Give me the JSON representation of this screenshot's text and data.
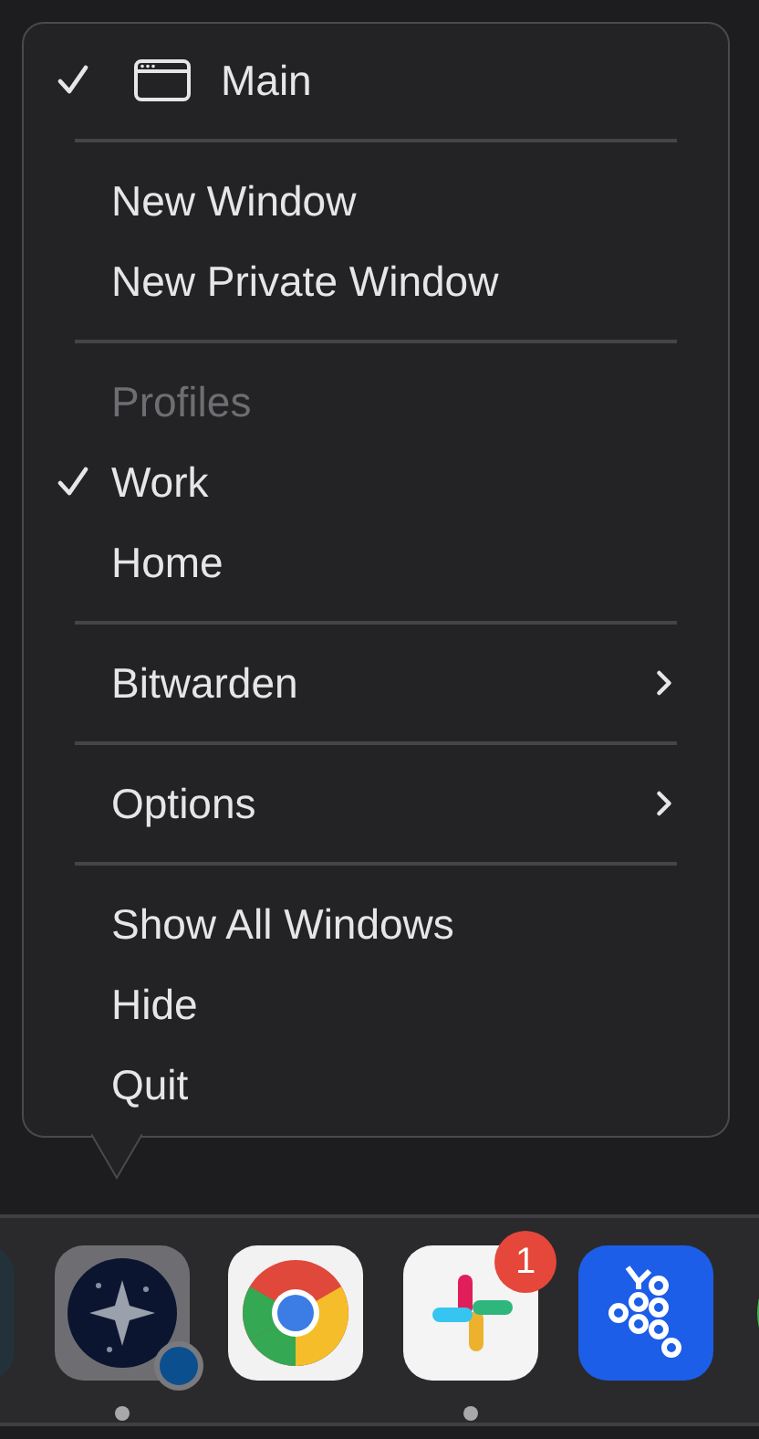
{
  "menu": {
    "sections": [
      {
        "items": [
          {
            "kind": "window",
            "label": "Main",
            "checked": true
          }
        ]
      },
      {
        "items": [
          {
            "kind": "item",
            "label": "New Window",
            "checked": false
          },
          {
            "kind": "item",
            "label": "New Private Window",
            "checked": false
          }
        ]
      },
      {
        "items": [
          {
            "kind": "header",
            "label": "Profiles"
          },
          {
            "kind": "item",
            "label": "Work",
            "checked": true
          },
          {
            "kind": "item",
            "label": "Home",
            "checked": false
          }
        ]
      },
      {
        "items": [
          {
            "kind": "submenu",
            "label": "Bitwarden",
            "checked": false
          }
        ]
      },
      {
        "items": [
          {
            "kind": "submenu",
            "label": "Options",
            "checked": false
          }
        ]
      },
      {
        "items": [
          {
            "kind": "item",
            "label": "Show All Windows",
            "checked": false
          },
          {
            "kind": "item",
            "label": "Hide",
            "checked": false
          },
          {
            "kind": "item",
            "label": "Quit",
            "checked": false
          }
        ]
      }
    ]
  },
  "dock": {
    "apps": [
      {
        "kind": "partial-dark",
        "running": false
      },
      {
        "kind": "sparkle",
        "running": true,
        "status_dot": true
      },
      {
        "kind": "ring",
        "running": false
      },
      {
        "kind": "hash",
        "running": true,
        "badge": "1"
      },
      {
        "kind": "grapes",
        "running": false
      },
      {
        "kind": "partial-green",
        "running": false
      }
    ]
  }
}
